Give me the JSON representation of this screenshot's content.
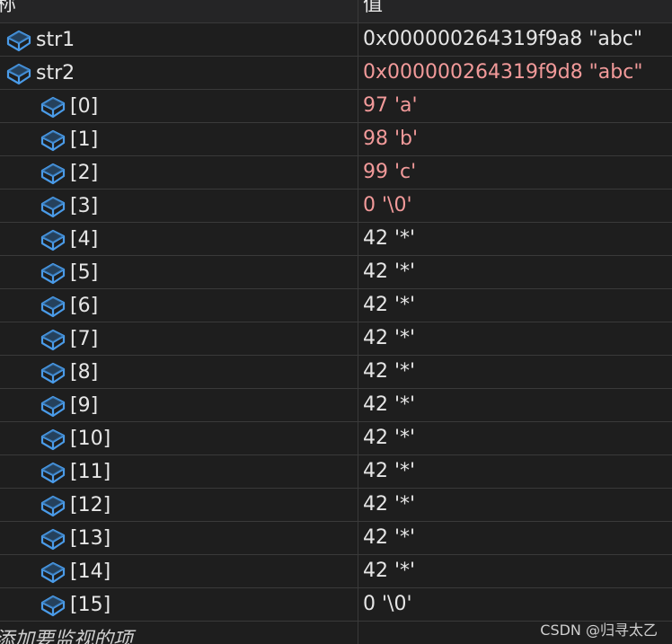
{
  "header": {
    "name_col": "称",
    "value_col": "值"
  },
  "rows": [
    {
      "name": "str1",
      "value": "0x000000264319f9a8 \"abc\"",
      "changed": false
    },
    {
      "name": "str2",
      "value": "0x000000264319f9d8 \"abc\"",
      "changed": true
    },
    {
      "name": "[0]",
      "value": "97 'a'",
      "changed": true
    },
    {
      "name": "[1]",
      "value": "98 'b'",
      "changed": true
    },
    {
      "name": "[2]",
      "value": "99 'c'",
      "changed": true
    },
    {
      "name": "[3]",
      "value": "0 '\\0'",
      "changed": true
    },
    {
      "name": "[4]",
      "value": "42 '*'",
      "changed": false
    },
    {
      "name": "[5]",
      "value": "42 '*'",
      "changed": false
    },
    {
      "name": "[6]",
      "value": "42 '*'",
      "changed": false
    },
    {
      "name": "[7]",
      "value": "42 '*'",
      "changed": false
    },
    {
      "name": "[8]",
      "value": "42 '*'",
      "changed": false
    },
    {
      "name": "[9]",
      "value": "42 '*'",
      "changed": false
    },
    {
      "name": "[10]",
      "value": "42 '*'",
      "changed": false
    },
    {
      "name": "[11]",
      "value": "42 '*'",
      "changed": false
    },
    {
      "name": "[12]",
      "value": "42 '*'",
      "changed": false
    },
    {
      "name": "[13]",
      "value": "42 '*'",
      "changed": false
    },
    {
      "name": "[14]",
      "value": "42 '*'",
      "changed": false
    },
    {
      "name": "[15]",
      "value": "0 '\\0'",
      "changed": false
    }
  ],
  "add_watch_text": "添加要监视的项",
  "watermark": "CSDN @归寻太乙",
  "colors": {
    "changed_value": "#f29a9a",
    "icon_blue": "#4a9be8"
  },
  "icon": "field-icon"
}
